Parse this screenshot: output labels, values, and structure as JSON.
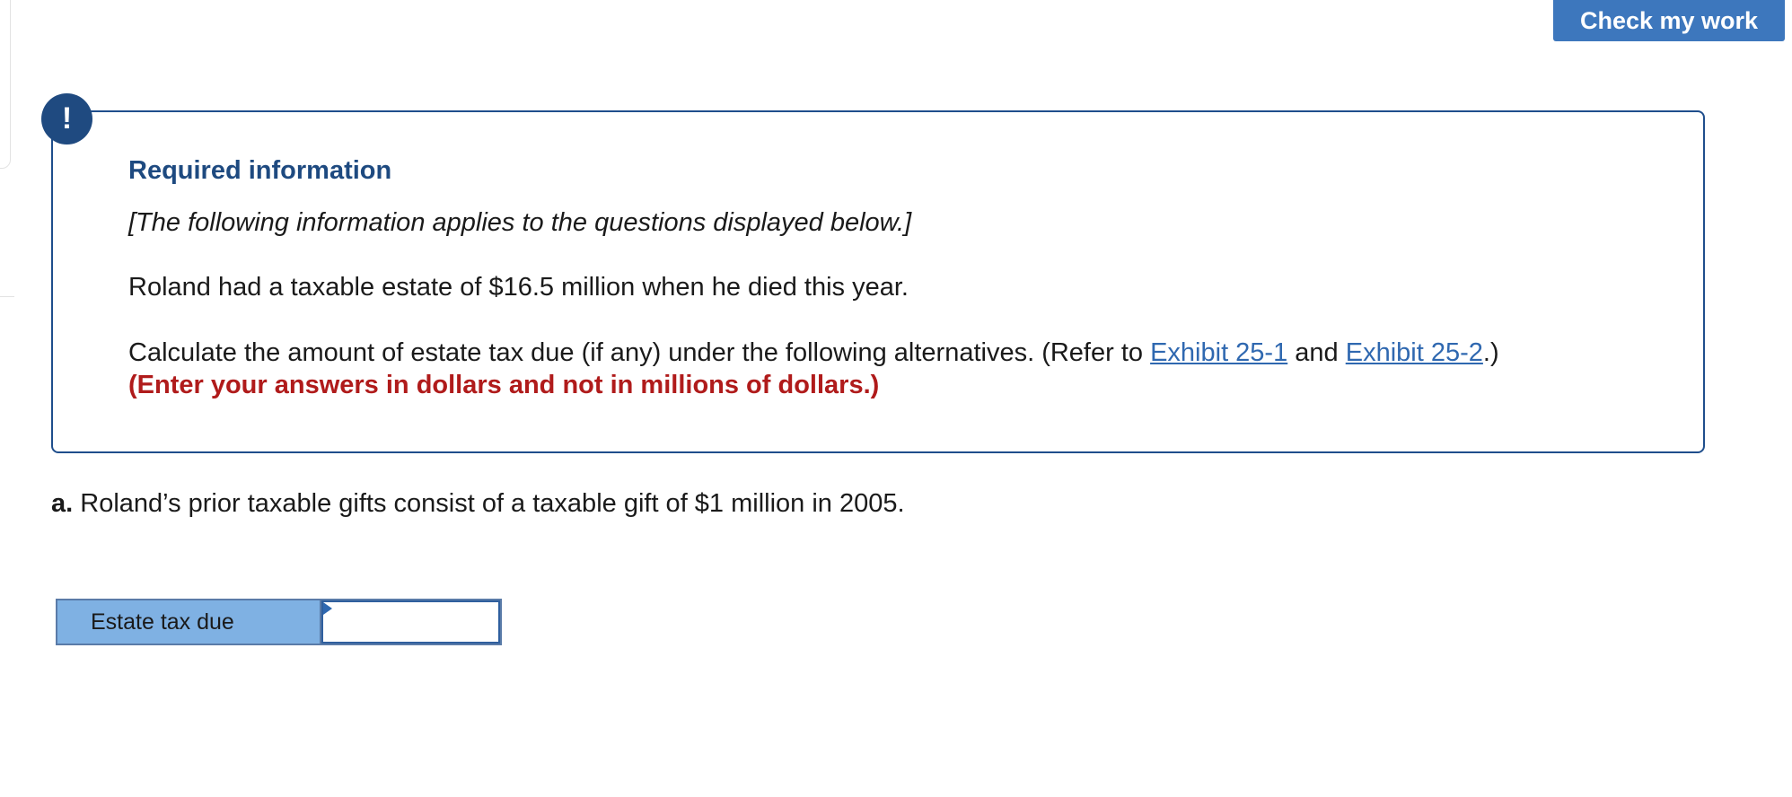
{
  "toolbar": {
    "check_label": "Check my work"
  },
  "info": {
    "icon": "!",
    "title": "Required information",
    "subtitle": "[The following information applies to the questions displayed below.]",
    "line1": "Roland had a taxable estate of $16.5 million when he died this year.",
    "line2_prefix": "Calculate the amount of estate tax due (if any) under the following alternatives. (Refer to ",
    "link1": "Exhibit 25-1",
    "line2_mid": " and ",
    "link2": "Exhibit 25-2",
    "line2_suffix": ".)",
    "instruction": "(Enter your answers in dollars and not in millions of dollars.)"
  },
  "question": {
    "prefix": "a.",
    "text": " Roland’s prior taxable gifts consist of a taxable gift of $1 million in 2005."
  },
  "answer": {
    "label": "Estate tax due",
    "value": ""
  },
  "colors": {
    "accent_blue": "#3d77bd",
    "dark_blue": "#1f4a80",
    "link_blue": "#2f68b0",
    "alert_red": "#b01b1b",
    "label_bg": "#7fb1e3"
  }
}
